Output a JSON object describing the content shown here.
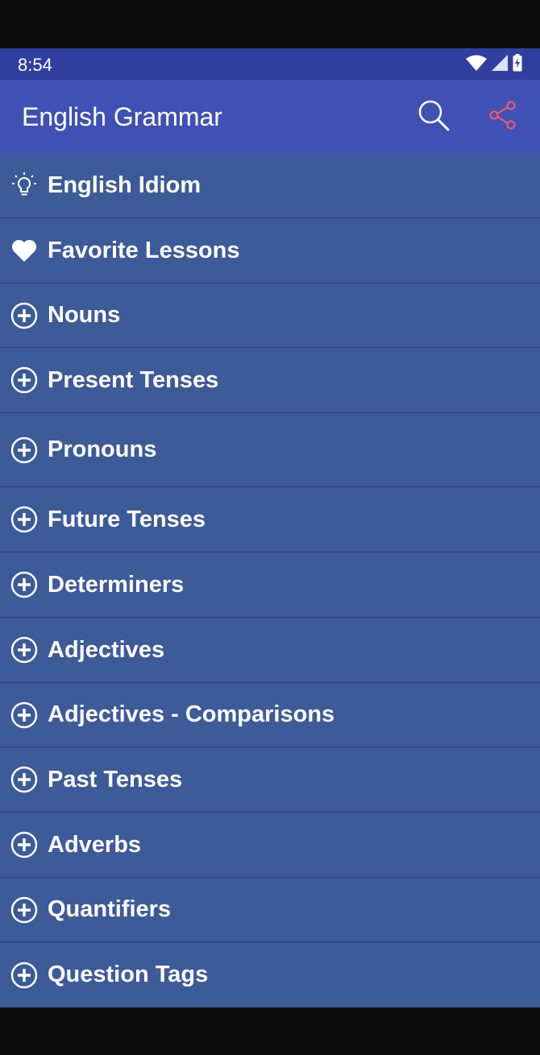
{
  "status_bar": {
    "time": "8:54",
    "icons": [
      "wifi-icon",
      "cellular-signal-icon",
      "battery-charging-icon"
    ]
  },
  "app_bar": {
    "title": "English Grammar",
    "actions": [
      {
        "name": "search",
        "icon": "search-icon",
        "color": "#ffffff"
      },
      {
        "name": "share",
        "icon": "share-icon",
        "color": "#ff5c5c"
      }
    ],
    "background": "#3f51b5"
  },
  "menu": {
    "background": "#3d5a99",
    "items": [
      {
        "label": "English Idiom",
        "icon": "lightbulb-icon"
      },
      {
        "label": "Favorite Lessons",
        "icon": "heart-icon"
      },
      {
        "label": "Nouns",
        "icon": "plus-circle-icon"
      },
      {
        "label": "Present Tenses",
        "icon": "plus-circle-icon"
      },
      {
        "label": "Pronouns",
        "icon": "plus-circle-icon"
      },
      {
        "label": "Future Tenses",
        "icon": "plus-circle-icon"
      },
      {
        "label": "Determiners",
        "icon": "plus-circle-icon"
      },
      {
        "label": "Adjectives",
        "icon": "plus-circle-icon"
      },
      {
        "label": "Adjectives - Comparisons",
        "icon": "plus-circle-icon"
      },
      {
        "label": "Past Tenses",
        "icon": "plus-circle-icon"
      },
      {
        "label": "Adverbs",
        "icon": "plus-circle-icon"
      },
      {
        "label": "Quantifiers",
        "icon": "plus-circle-icon"
      },
      {
        "label": "Question Tags",
        "icon": "plus-circle-icon"
      }
    ]
  }
}
